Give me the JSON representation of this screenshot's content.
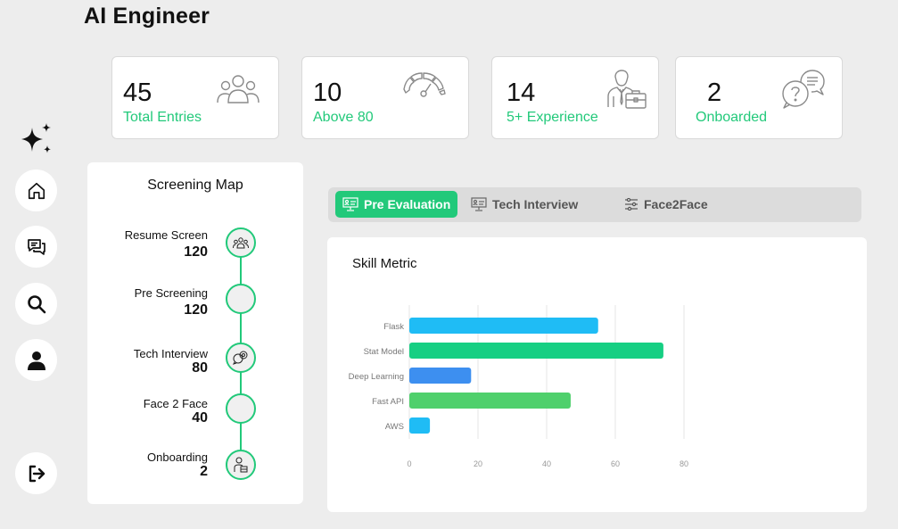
{
  "page": {
    "title": "AI Engineer"
  },
  "stats": [
    {
      "value": "45",
      "label": "Total Entries",
      "icon": "users-group-icon"
    },
    {
      "value": "10",
      "label": "Above 80",
      "icon": "gauge-icon"
    },
    {
      "value": "14",
      "label": "5+ Experience",
      "icon": "businessman-icon"
    },
    {
      "value": "2",
      "label": "Onboarded",
      "icon": "chat-question-icon"
    }
  ],
  "sidebar": {
    "items": [
      {
        "name": "home",
        "icon": "home-icon"
      },
      {
        "name": "messages",
        "icon": "chat-icon"
      },
      {
        "name": "search",
        "icon": "search-icon"
      },
      {
        "name": "profile",
        "icon": "user-icon"
      },
      {
        "name": "logout",
        "icon": "logout-icon"
      }
    ]
  },
  "screening_map": {
    "title": "Screening Map",
    "stages": [
      {
        "name": "Resume Screen",
        "count": "120",
        "icon": "people-icon"
      },
      {
        "name": "Pre Screening",
        "count": "120",
        "icon": ""
      },
      {
        "name": "Tech Interview",
        "count": "80",
        "icon": "interview-icon"
      },
      {
        "name": "Face 2 Face",
        "count": "40",
        "icon": ""
      },
      {
        "name": "Onboarding",
        "count": "2",
        "icon": "onboard-icon"
      }
    ]
  },
  "tabs": [
    {
      "label": "Pre Evaluation",
      "active": true,
      "icon": "monitor-icon"
    },
    {
      "label": "Tech Interview",
      "active": false,
      "icon": "monitor-icon"
    },
    {
      "label": "Face2Face",
      "active": false,
      "icon": "sliders-icon"
    }
  ],
  "skill_metric": {
    "title": "Skill Metric"
  },
  "chart_data": {
    "type": "bar",
    "orientation": "horizontal",
    "title": "Skill Metric",
    "categories": [
      "Flask",
      "Stat Model",
      "Deep Learning",
      "Fast API",
      "AWS"
    ],
    "values": [
      55,
      74,
      18,
      47,
      6
    ],
    "colors": [
      "#1fbcf5",
      "#16cf83",
      "#3d8ff0",
      "#4fd06c",
      "#1fbcf5"
    ],
    "xticks": [
      "0",
      "20",
      "40",
      "60",
      "80"
    ],
    "xlim": [
      0,
      80
    ],
    "grid": true,
    "xlabel": "",
    "ylabel": ""
  },
  "colors": {
    "accent": "#22c97a",
    "background": "#ededed"
  }
}
